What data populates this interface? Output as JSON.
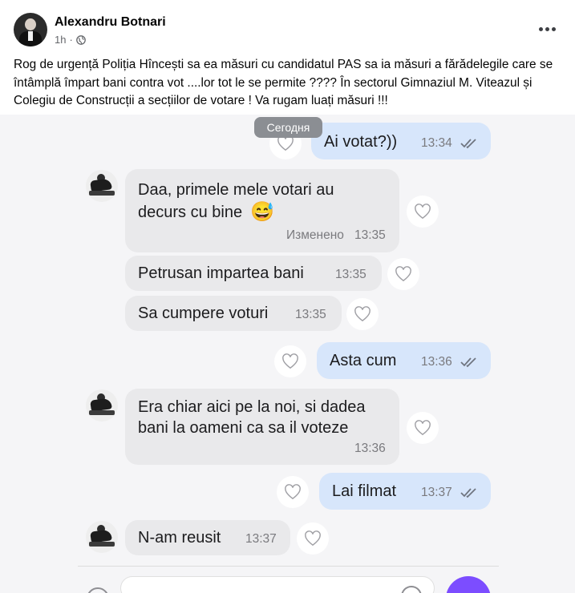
{
  "post": {
    "author": "Alexandru Botnari",
    "time": "1h",
    "separator": "·",
    "privacy_icon": "globe-icon",
    "more_label": "More options",
    "text": "Rog de urgență Poliția  Hîncești sa ea măsuri cu candidatul PAS sa ia măsuri a fărădelegile care se întâmplă împart bani contra vot ....lor tot le se permite ???? În sectorul Gimnaziul M. Viteazul și Colegiu de Construcții a secțiilor de votare  ! Va rugam luați măsuri  !!!"
  },
  "chat": {
    "date_label": "Сегодня",
    "messages": [
      {
        "direction": "out",
        "text": "Ai votat?))",
        "time": "13:34"
      },
      {
        "direction": "in",
        "line1": "Daa, primele mele votari au",
        "line2": "decurs cu bine",
        "emoji": "😅",
        "edited": "Изменено",
        "time": "13:35"
      },
      {
        "direction": "in",
        "text": "Petrusan impartea bani",
        "time": "13:35"
      },
      {
        "direction": "in",
        "text": "Sa cumpere voturi",
        "time": "13:35"
      },
      {
        "direction": "out",
        "text": "Asta cum",
        "time": "13:36"
      },
      {
        "direction": "in",
        "line1": "Era chiar aici pe la noi, si dadea",
        "line2": "bani la oameni ca sa il voteze",
        "time": "13:36"
      },
      {
        "direction": "out",
        "text": "Lai filmat",
        "time": "13:37"
      },
      {
        "direction": "in",
        "text": "N-am reusit",
        "time": "13:37"
      }
    ]
  },
  "colors": {
    "incoming_bubble": "#e9e9eb",
    "outgoing_bubble": "#d7e6fb",
    "send_button": "#7c4dff",
    "meta_text": "#65676b"
  }
}
